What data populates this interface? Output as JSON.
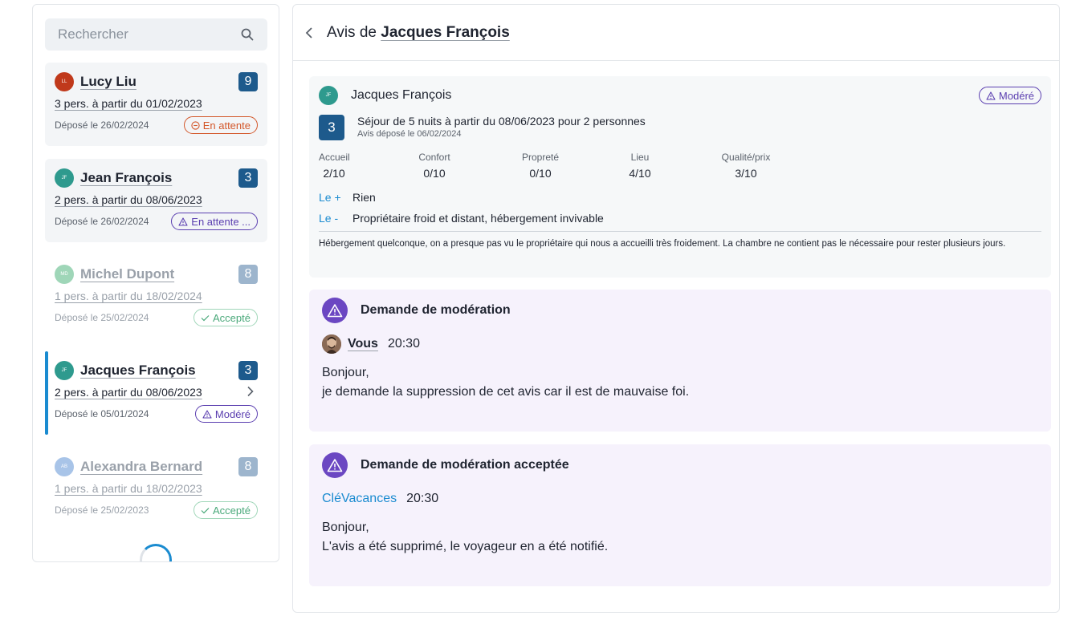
{
  "search": {
    "placeholder": "Rechercher",
    "icon": "search-icon"
  },
  "list": [
    {
      "initials": "LL",
      "avatar_color": "#c0391b",
      "name": "Lucy Liu",
      "count": "9",
      "stay": "3 pers. à partir du 01/02/2023",
      "date": "Déposé le 26/02/2024",
      "status": "En attente",
      "status_icon": "minus-circle-icon"
    },
    {
      "initials": "JF",
      "avatar_color": "#2e9a8e",
      "name": "Jean François",
      "count": "3",
      "stay": "2 pers. à partir du 08/06/2023",
      "date": "Déposé le 26/02/2024",
      "status": "En attente ...",
      "status_icon": "warning-icon"
    },
    {
      "initials": "MD",
      "avatar_color": "#9fd6b8",
      "name": "Michel Dupont",
      "count": "8",
      "stay": "1 pers. à partir du 18/02/2024",
      "date": "Déposé le 25/02/2024",
      "status": "Accepté",
      "status_icon": "check-icon"
    },
    {
      "initials": "JF",
      "avatar_color": "#2e9a8e",
      "name": "Jacques François",
      "count": "3",
      "stay": "2 pers. à partir du 08/06/2023",
      "date": "Déposé le 05/01/2024",
      "status": "Modéré",
      "status_icon": "warning-icon"
    },
    {
      "initials": "AB",
      "avatar_color": "#a8c4e8",
      "name": "Alexandra Bernard",
      "count": "8",
      "stay": "1 pers. à partir du 18/02/2023",
      "date": "Déposé le 25/02/2023",
      "status": "Accepté",
      "status_icon": "check-icon"
    }
  ],
  "header": {
    "title_prefix": "Avis de",
    "title_name": "Jacques François"
  },
  "review": {
    "initials": "JF",
    "author": "Jacques François",
    "status": "Modéré",
    "stay_count": "3",
    "stay_desc": "Séjour de 5 nuits à partir du 08/06/2023 pour 2 personnes",
    "stay_sub": "Avis déposé le 06/02/2024",
    "ratings": [
      {
        "label": "Accueil",
        "value": "2/10"
      },
      {
        "label": "Confort",
        "value": "0/10"
      },
      {
        "label": "Propreté",
        "value": "0/10"
      },
      {
        "label": "Lieu",
        "value": "4/10"
      },
      {
        "label": "Qualité/prix",
        "value": "3/10"
      }
    ],
    "plus_key": "Le +",
    "plus_val": "Rien",
    "minus_key": "Le -",
    "minus_val": "Propriétaire froid et distant, hébergement invivable",
    "text": "Hébergement quelconque, on a presque pas vu le propriétaire qui nous a accueilli très froidement. La chambre ne contient pas le nécessaire pour rester plusieurs jours."
  },
  "moderation_request": {
    "title": "Demande de modération",
    "author": "Vous",
    "time": "20:30",
    "line1": "Bonjour,",
    "line2": "je demande la suppression de cet avis car il est de mauvaise foi."
  },
  "moderation_accepted": {
    "title": "Demande de modération acceptée",
    "brand": "CléVacances",
    "time": "20:30",
    "line1": "Bonjour,",
    "line2": "L'avis a été supprimé, le voyageur en a été notifié."
  },
  "colors": {
    "accent": "#1a8bd0",
    "count_bg": "#1d5a8c",
    "moderation": "#6b47c2",
    "pending": "#d3572a"
  }
}
